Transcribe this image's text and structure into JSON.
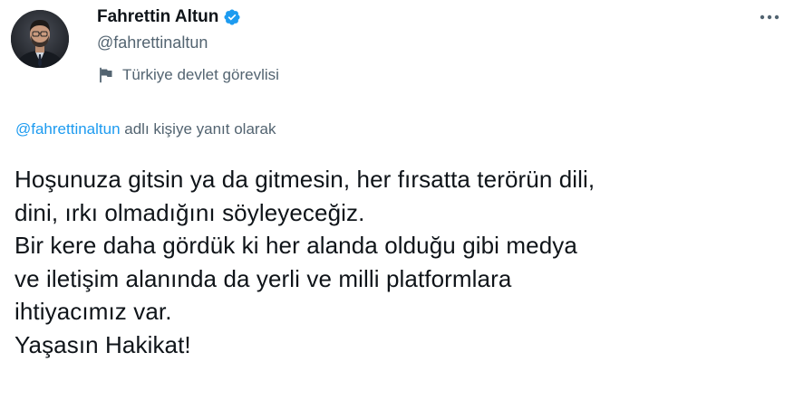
{
  "author": {
    "name": "Fahrettin Altun",
    "handle": "@fahrettinaltun",
    "label": "Türkiye devlet görevlisi",
    "verified": true,
    "avatar_icon": "profile-photo"
  },
  "reply": {
    "handle": "@fahrettinaltun",
    "suffix": " adlı kişiye yanıt olarak"
  },
  "tweet": {
    "lines": [
      "Hoşunuza gitsin ya da gitmesin, her fırsatta terörün dili,",
      "dini, ırkı olmadığını söyleyeceğiz.",
      "Bir kere daha gördük ki her alanda olduğu gibi medya",
      "ve iletişim alanında da yerli ve milli platformlara",
      "ihtiyacımız var.",
      "Yaşasın Hakikat!"
    ]
  },
  "colors": {
    "accent": "#1d9bf0",
    "secondary_text": "#536471",
    "primary_text": "#0f1419"
  },
  "icons": {
    "verified": "verified-badge-icon",
    "label": "flag-icon",
    "more": "more-options-icon"
  }
}
